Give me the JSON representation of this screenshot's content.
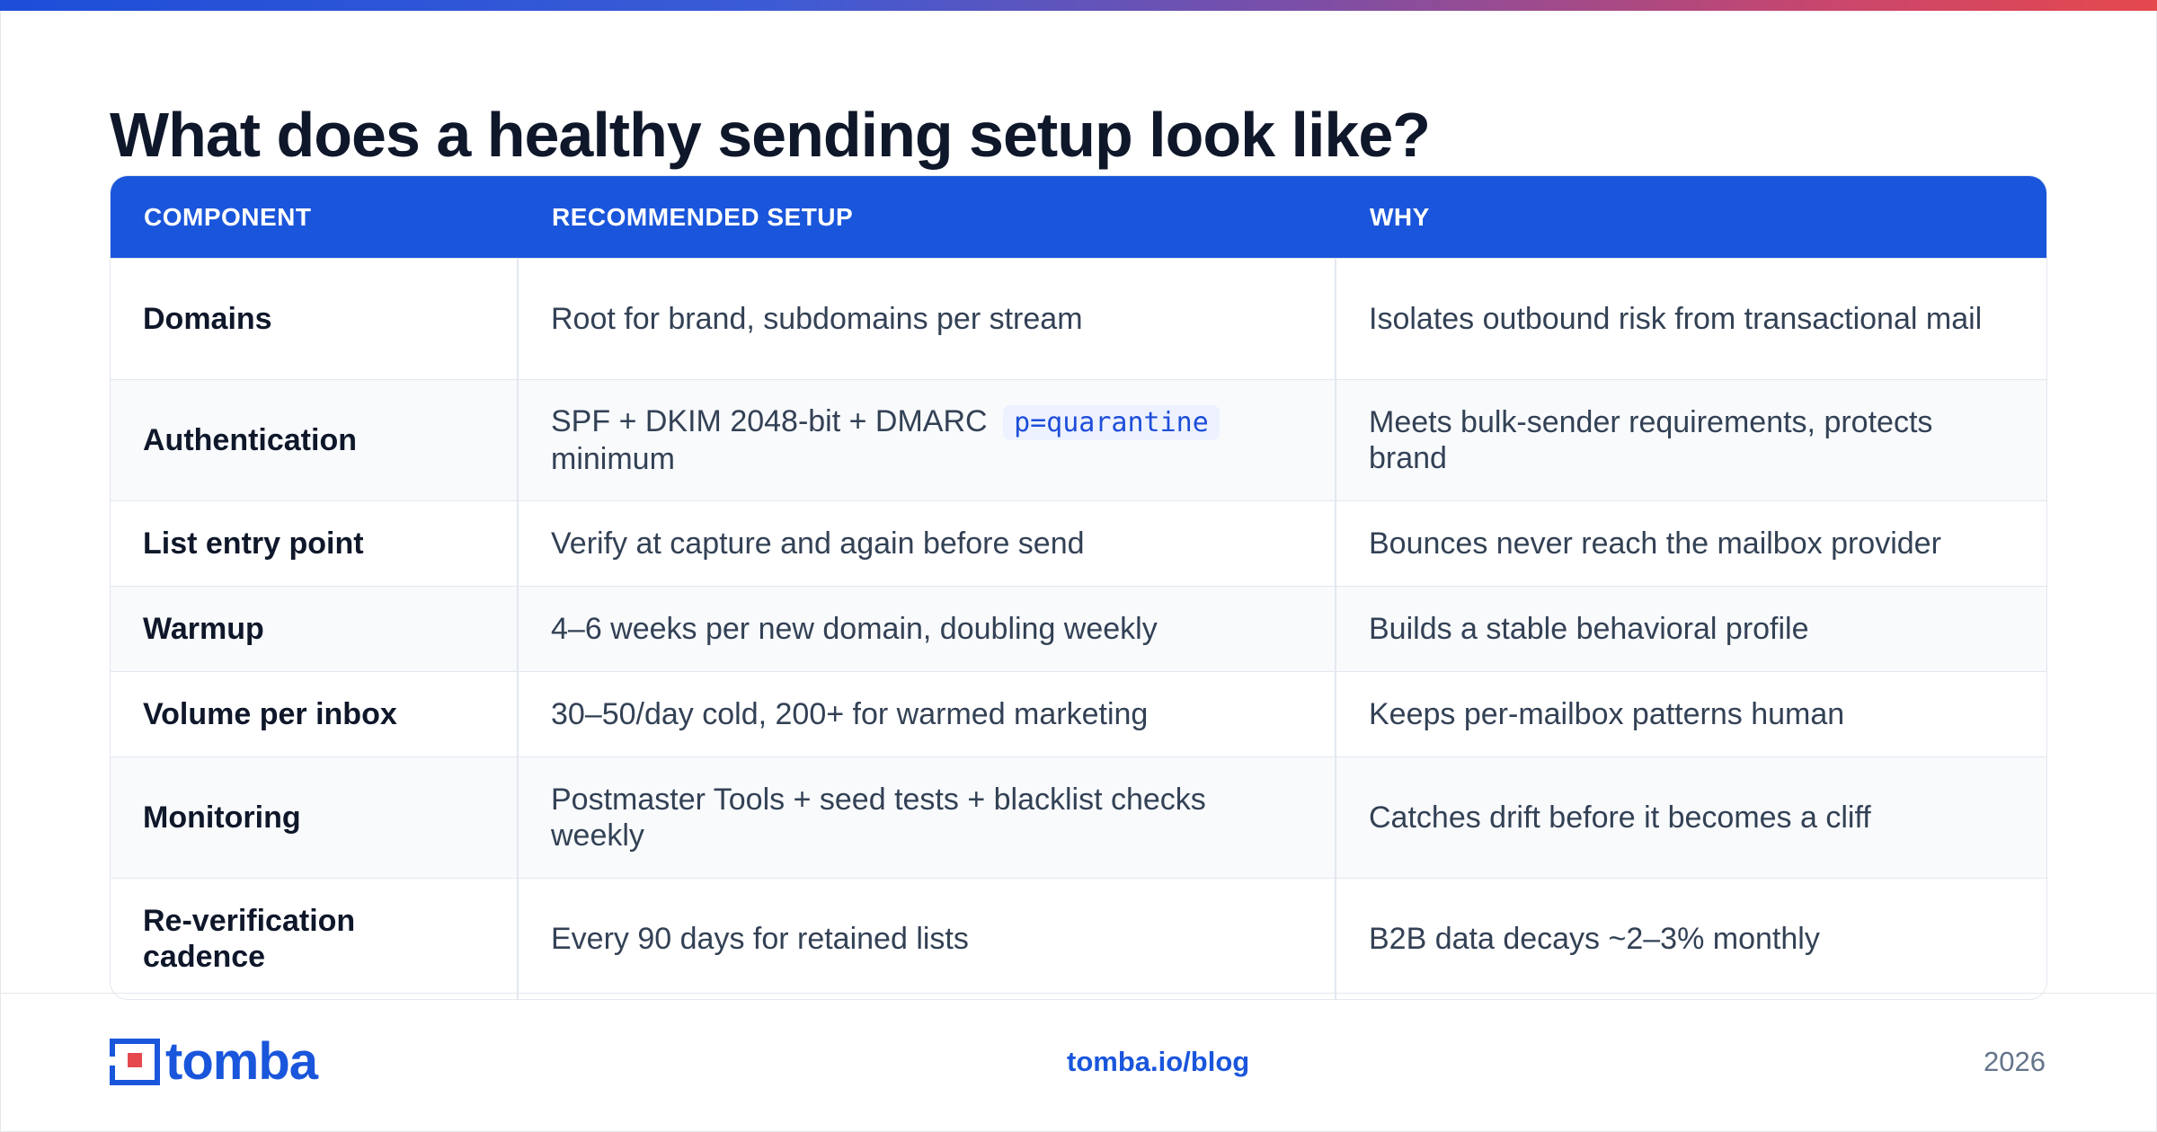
{
  "page": {
    "title": "What does a healthy sending setup look like?"
  },
  "table": {
    "headers": [
      "COMPONENT",
      "RECOMMENDED SETUP",
      "WHY"
    ],
    "rows": [
      {
        "component": "Domains",
        "setup": "Root for brand, subdomains per stream",
        "why": "Isolates outbound risk from transactional mail"
      },
      {
        "component": "Authentication",
        "setup_before": "SPF + DKIM 2048-bit + DMARC",
        "setup_code": "p=quarantine",
        "setup_after": "minimum",
        "why": "Meets bulk-sender requirements, protects brand"
      },
      {
        "component": "List entry point",
        "setup": "Verify at capture and again before send",
        "why": "Bounces never reach the mailbox provider"
      },
      {
        "component": "Warmup",
        "setup": "4–6 weeks per new domain, doubling weekly",
        "why": "Builds a stable behavioral profile"
      },
      {
        "component": "Volume per inbox",
        "setup": "30–50/day cold, 200+ for warmed marketing",
        "why": "Keeps per-mailbox patterns human"
      },
      {
        "component": "Monitoring",
        "setup": "Postmaster Tools + seed tests + blacklist checks weekly",
        "why": "Catches drift before it becomes a cliff"
      },
      {
        "component": "Re-verification cadence",
        "setup": "Every 90 days for retained lists",
        "why": "B2B data decays ~2–3% monthly"
      }
    ]
  },
  "footer": {
    "logo_text": "tomba",
    "link": "tomba.io/blog",
    "year": "2026"
  },
  "colors": {
    "accent": "#1a56db",
    "header_bg": "#1a56db",
    "gradient_start": "#1d4ed8",
    "gradient_end": "#e5484d"
  }
}
